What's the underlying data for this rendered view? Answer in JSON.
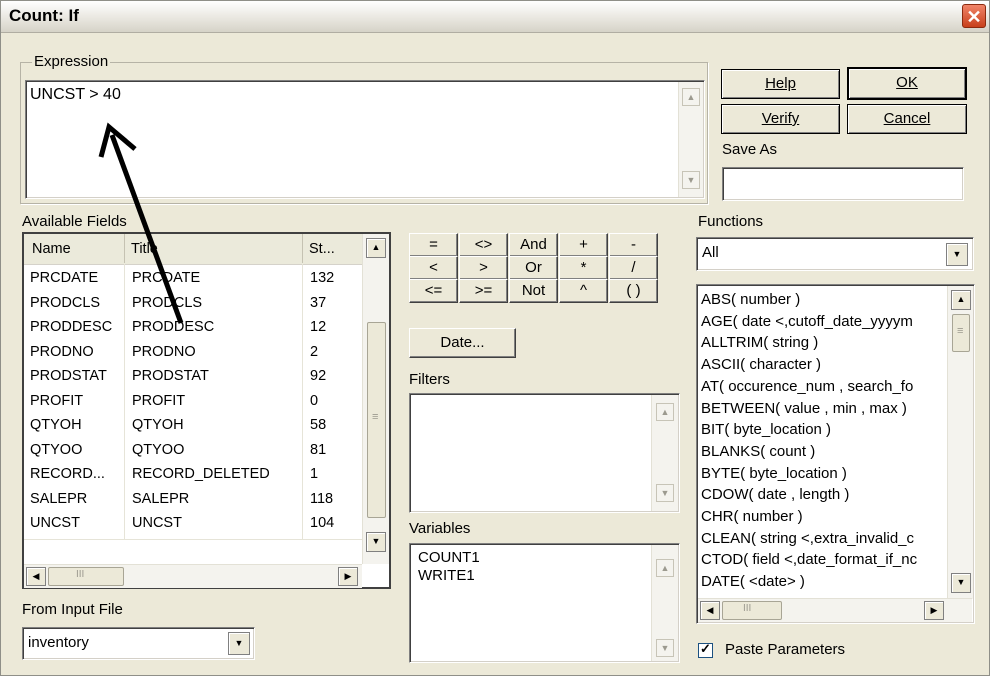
{
  "window": {
    "title": "Count: If",
    "close": "✕"
  },
  "expression": {
    "group_label": "Expression",
    "value": "UNCST > 40"
  },
  "buttons": {
    "help": "Help",
    "ok": "OK",
    "verify": "Verify",
    "cancel": "Cancel",
    "date": "Date..."
  },
  "save_as": {
    "label": "Save As",
    "value": ""
  },
  "available_fields": {
    "label": "Available Fields",
    "columns": [
      "Name",
      "Title",
      "St..."
    ],
    "rows": [
      [
        "PRCDATE",
        "PRCDATE",
        "132"
      ],
      [
        "PRODCLS",
        "PRODCLS",
        "37"
      ],
      [
        "PRODDESC",
        "PRODDESC",
        "12"
      ],
      [
        "PRODNO",
        "PRODNO",
        "2"
      ],
      [
        "PRODSTAT",
        "PRODSTAT",
        "92"
      ],
      [
        "PROFIT",
        "PROFIT",
        "0"
      ],
      [
        "QTYOH",
        "QTYOH",
        "58"
      ],
      [
        "QTYOO",
        "QTYOO",
        "81"
      ],
      [
        "RECORD...",
        "RECORD_DELETED",
        "1"
      ],
      [
        "SALEPR",
        "SALEPR",
        "118"
      ],
      [
        "UNCST",
        "UNCST",
        "104"
      ]
    ]
  },
  "operators": [
    "=",
    "<>",
    "And",
    "+",
    "-",
    "<",
    ">",
    "Or",
    "*",
    "/",
    "<=",
    ">=",
    "Not",
    "^",
    "( )"
  ],
  "filters": {
    "label": "Filters"
  },
  "variables": {
    "label": "Variables",
    "items": [
      "COUNT1",
      "WRITE1"
    ]
  },
  "from_input_file": {
    "label": "From Input File",
    "value": "inventory"
  },
  "functions": {
    "label": "Functions",
    "category": "All",
    "items": [
      "ABS( number )",
      "AGE( date <,cutoff_date_yyyym",
      "ALLTRIM( string )",
      "ASCII( character )",
      "AT( occurence_num , search_fo",
      "BETWEEN( value , min , max )",
      "BIT( byte_location )",
      "BLANKS( count )",
      "BYTE( byte_location )",
      "CDOW( date , length )",
      "CHR( number )",
      "CLEAN( string <,extra_invalid_c",
      "CTOD( field <,date_format_if_nc",
      "DATE( <date> )"
    ]
  },
  "paste_parameters": {
    "label": "Paste Parameters",
    "checked": true
  },
  "glyphs": {
    "up": "▲",
    "down": "▼",
    "left": "◀",
    "right": "▶",
    "grip": "≡",
    "thumb": "III",
    "check": "✓"
  }
}
